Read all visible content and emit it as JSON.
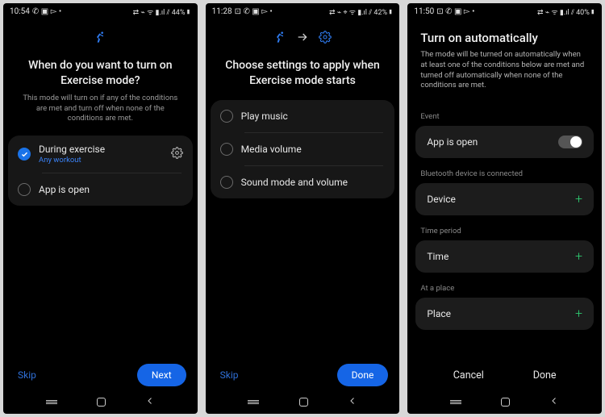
{
  "screen1": {
    "status": {
      "time": "10:54",
      "left_icons": "✆ ▣ ▻ •",
      "right_icons": "⇄ ⌁ ᯤ ▮.ıl ⫽ 44%▮"
    },
    "title": "When do you want to turn on Exercise mode?",
    "subtitle": "This mode will turn on if any of the conditions are met and turn off when none of the conditions are met.",
    "options": [
      {
        "label": "During exercise",
        "sub": "Any workout",
        "checked": true,
        "gear": true
      },
      {
        "label": "App is open",
        "checked": false
      }
    ],
    "skip": "Skip",
    "next": "Next"
  },
  "screen2": {
    "status": {
      "time": "11:28",
      "left_icons": "⊡ ✆ ▣ ▻ •",
      "right_icons": "⇄ ⌁ ⌖ ᯤ ▮.ıl ⫽ 42%▮"
    },
    "title": "Choose settings to apply when Exercise mode starts",
    "options": [
      {
        "label": "Play music"
      },
      {
        "label": "Media volume"
      },
      {
        "label": "Sound mode and volume"
      }
    ],
    "skip": "Skip",
    "done": "Done"
  },
  "screen3": {
    "status": {
      "time": "11:50",
      "left_icons": "⊡ ✆ ▣ ▻ •",
      "right_icons": "⇄ ⌁ ᯤ ▮.ıl ⫽ 40%▮"
    },
    "title": "Turn on automatically",
    "subtitle": "The mode will be turned on automatically when at least one of the conditions below are met and turned off automatically when none of the conditions are met.",
    "sections": {
      "event": {
        "heading": "Event",
        "label": "App is open"
      },
      "bt": {
        "heading": "Bluetooth device is connected",
        "label": "Device"
      },
      "time": {
        "heading": "Time period",
        "label": "Time"
      },
      "place": {
        "heading": "At a place",
        "label": "Place"
      }
    },
    "cancel": "Cancel",
    "done": "Done"
  }
}
